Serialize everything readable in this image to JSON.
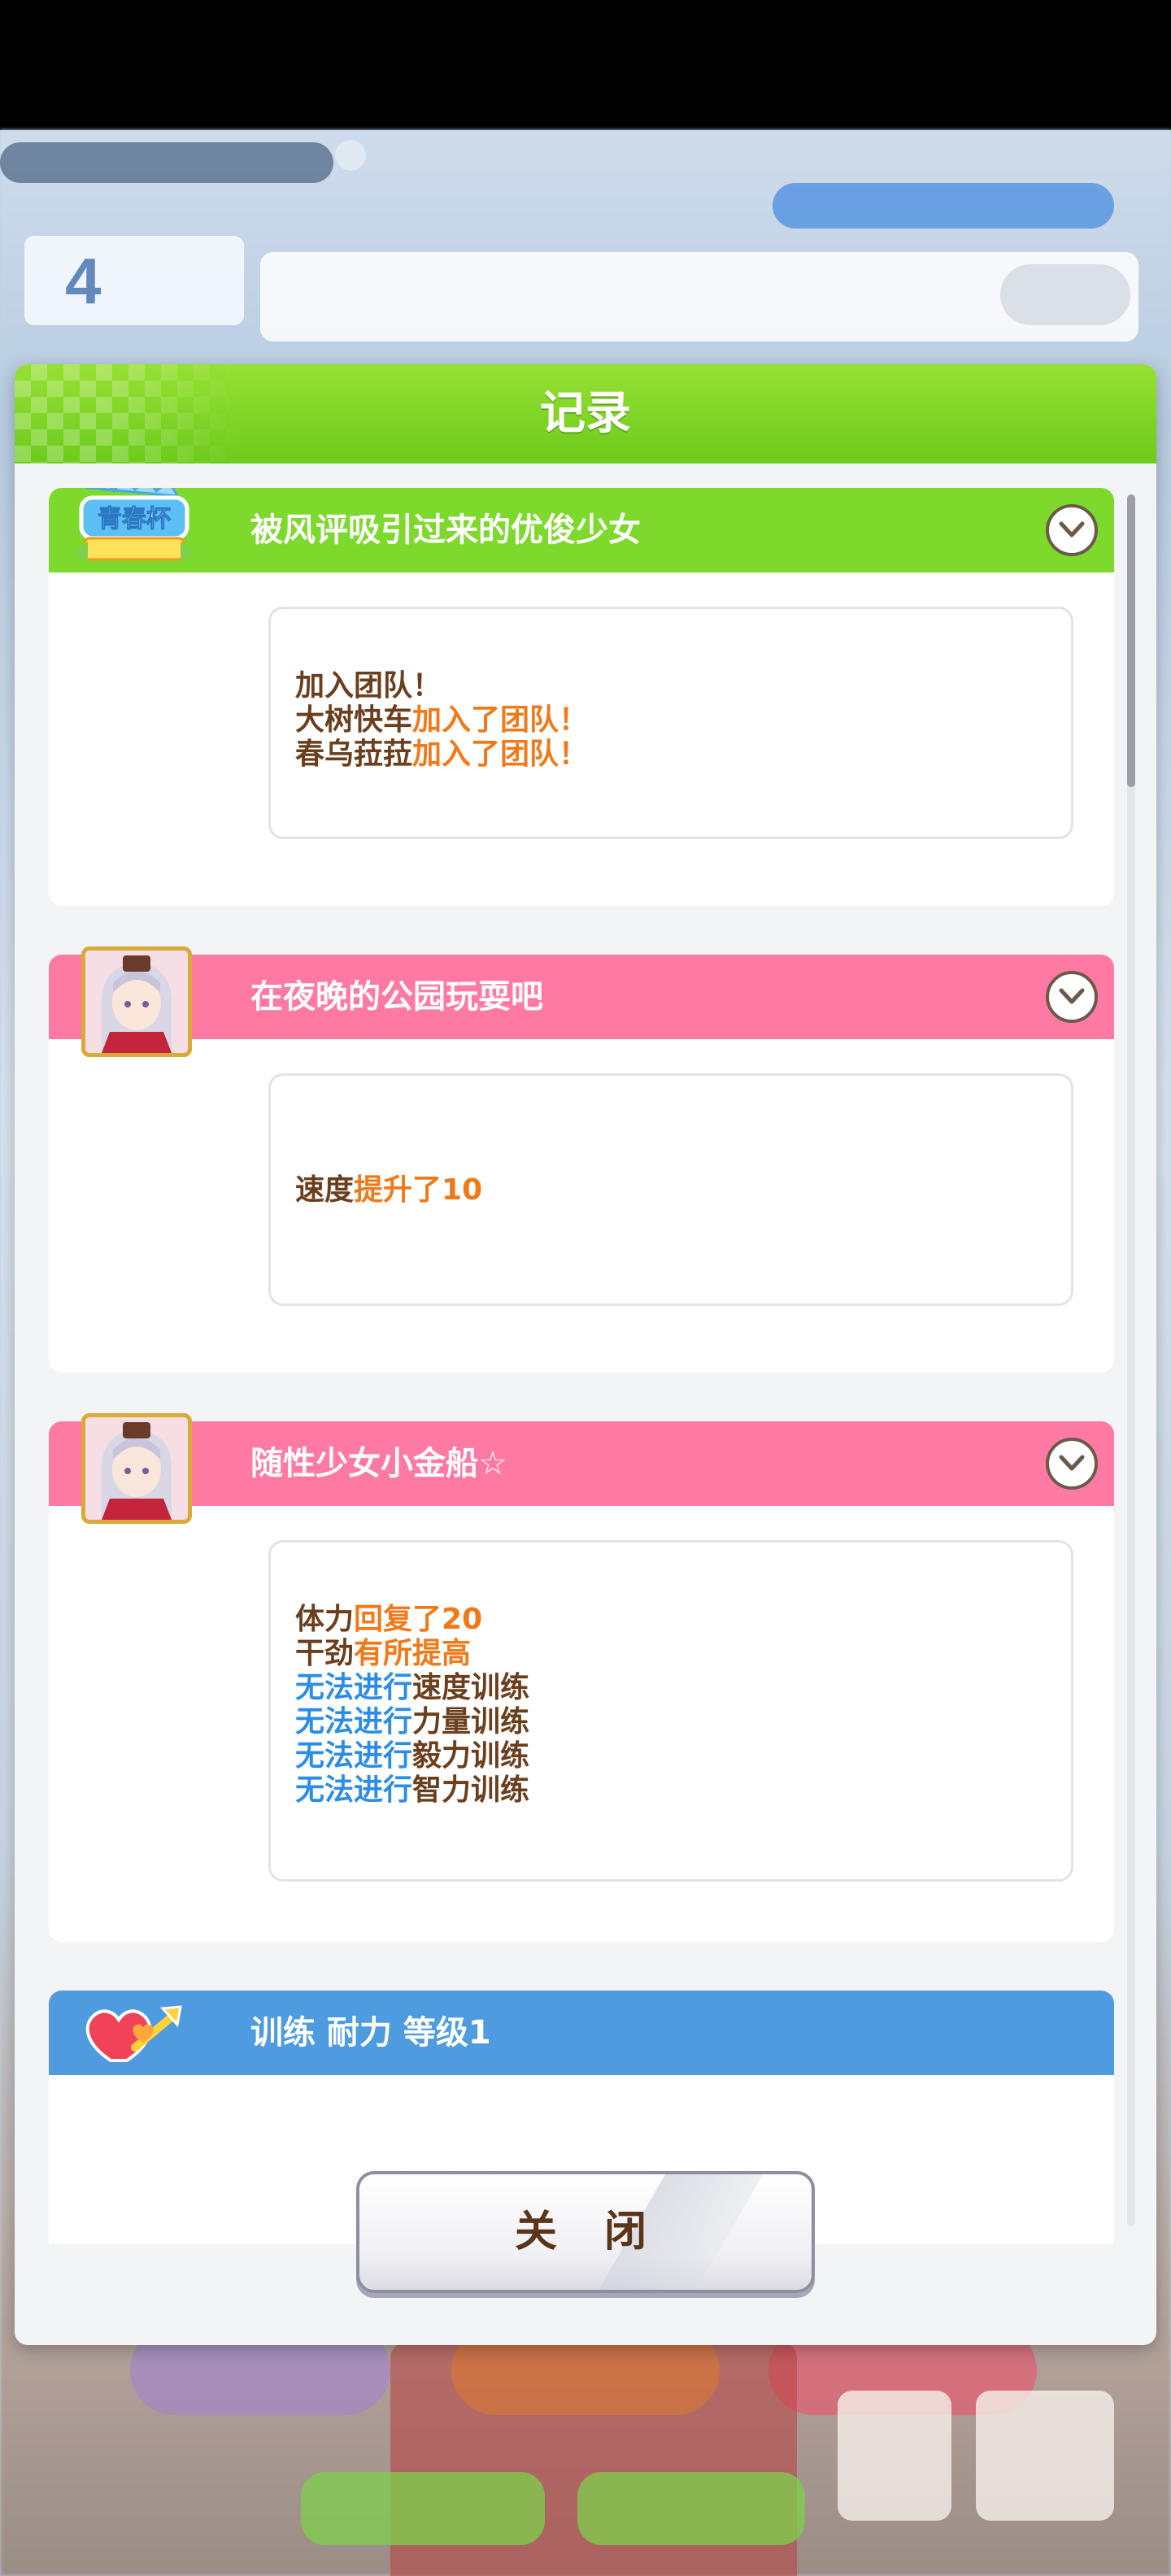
{
  "dialog": {
    "title": "记录",
    "close_label": "关 闭"
  },
  "background": {
    "turn_number": "4"
  },
  "entries": [
    {
      "title": "被风评吸引过来的优俊少女",
      "bar_color": "#7ed92d",
      "icon": "youth-cup-icon",
      "lines": [
        [
          {
            "text": "加入团队！",
            "color": "brown"
          }
        ],
        [
          {
            "text": "大树快车",
            "color": "brown"
          },
          {
            "text": "加入了团队！",
            "color": "orange"
          }
        ],
        [
          {
            "text": "春乌菈菈",
            "color": "brown"
          },
          {
            "text": "加入了团队！",
            "color": "orange"
          }
        ]
      ]
    },
    {
      "title": "在夜晚的公园玩耍吧",
      "bar_color": "#ff7aa2",
      "icon": "character-portrait",
      "lines": [
        [
          {
            "text": "速度",
            "color": "brown"
          },
          {
            "text": "提升了10",
            "color": "orange"
          }
        ]
      ]
    },
    {
      "title": "随性少女小金船☆",
      "bar_color": "#ff7aa2",
      "icon": "character-portrait",
      "lines": [
        [
          {
            "text": "体力",
            "color": "brown"
          },
          {
            "text": "回复了20",
            "color": "orange"
          }
        ],
        [
          {
            "text": "干劲",
            "color": "brown"
          },
          {
            "text": "有所提高",
            "color": "orange"
          }
        ],
        [
          {
            "text": "无法进行",
            "color": "blue"
          },
          {
            "text": "速度训练",
            "color": "brown"
          }
        ],
        [
          {
            "text": "无法进行",
            "color": "blue"
          },
          {
            "text": "力量训练",
            "color": "brown"
          }
        ],
        [
          {
            "text": "无法进行",
            "color": "blue"
          },
          {
            "text": "毅力训练",
            "color": "brown"
          }
        ],
        [
          {
            "text": "无法进行",
            "color": "blue"
          },
          {
            "text": "智力训练",
            "color": "brown"
          }
        ]
      ]
    },
    {
      "title": "训练 耐力 等级1",
      "bar_color": "#4e9be0",
      "icon": "heart-arrow-icon",
      "lines": []
    }
  ]
}
